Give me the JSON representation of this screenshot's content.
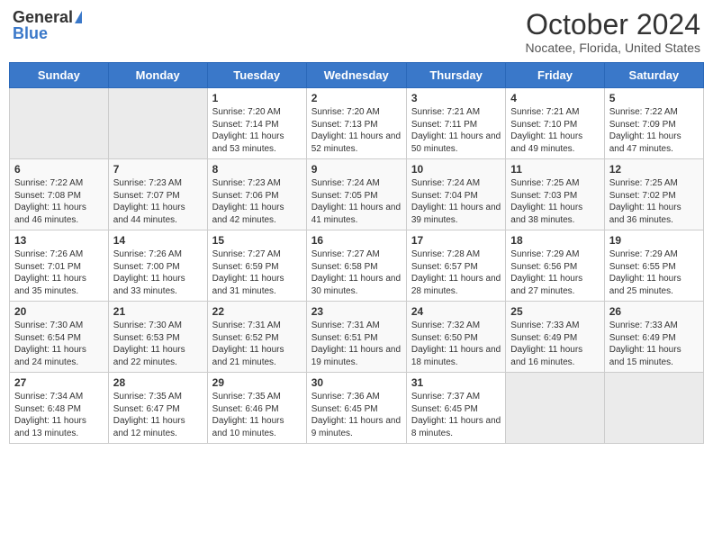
{
  "header": {
    "logo_general": "General",
    "logo_blue": "Blue",
    "month_title": "October 2024",
    "location": "Nocatee, Florida, United States"
  },
  "days_of_week": [
    "Sunday",
    "Monday",
    "Tuesday",
    "Wednesday",
    "Thursday",
    "Friday",
    "Saturday"
  ],
  "weeks": [
    [
      {
        "day": "",
        "sunrise": "",
        "sunset": "",
        "daylight": "",
        "empty": true
      },
      {
        "day": "",
        "sunrise": "",
        "sunset": "",
        "daylight": "",
        "empty": true
      },
      {
        "day": "1",
        "sunrise": "Sunrise: 7:20 AM",
        "sunset": "Sunset: 7:14 PM",
        "daylight": "Daylight: 11 hours and 53 minutes.",
        "empty": false
      },
      {
        "day": "2",
        "sunrise": "Sunrise: 7:20 AM",
        "sunset": "Sunset: 7:13 PM",
        "daylight": "Daylight: 11 hours and 52 minutes.",
        "empty": false
      },
      {
        "day": "3",
        "sunrise": "Sunrise: 7:21 AM",
        "sunset": "Sunset: 7:11 PM",
        "daylight": "Daylight: 11 hours and 50 minutes.",
        "empty": false
      },
      {
        "day": "4",
        "sunrise": "Sunrise: 7:21 AM",
        "sunset": "Sunset: 7:10 PM",
        "daylight": "Daylight: 11 hours and 49 minutes.",
        "empty": false
      },
      {
        "day": "5",
        "sunrise": "Sunrise: 7:22 AM",
        "sunset": "Sunset: 7:09 PM",
        "daylight": "Daylight: 11 hours and 47 minutes.",
        "empty": false
      }
    ],
    [
      {
        "day": "6",
        "sunrise": "Sunrise: 7:22 AM",
        "sunset": "Sunset: 7:08 PM",
        "daylight": "Daylight: 11 hours and 46 minutes.",
        "empty": false
      },
      {
        "day": "7",
        "sunrise": "Sunrise: 7:23 AM",
        "sunset": "Sunset: 7:07 PM",
        "daylight": "Daylight: 11 hours and 44 minutes.",
        "empty": false
      },
      {
        "day": "8",
        "sunrise": "Sunrise: 7:23 AM",
        "sunset": "Sunset: 7:06 PM",
        "daylight": "Daylight: 11 hours and 42 minutes.",
        "empty": false
      },
      {
        "day": "9",
        "sunrise": "Sunrise: 7:24 AM",
        "sunset": "Sunset: 7:05 PM",
        "daylight": "Daylight: 11 hours and 41 minutes.",
        "empty": false
      },
      {
        "day": "10",
        "sunrise": "Sunrise: 7:24 AM",
        "sunset": "Sunset: 7:04 PM",
        "daylight": "Daylight: 11 hours and 39 minutes.",
        "empty": false
      },
      {
        "day": "11",
        "sunrise": "Sunrise: 7:25 AM",
        "sunset": "Sunset: 7:03 PM",
        "daylight": "Daylight: 11 hours and 38 minutes.",
        "empty": false
      },
      {
        "day": "12",
        "sunrise": "Sunrise: 7:25 AM",
        "sunset": "Sunset: 7:02 PM",
        "daylight": "Daylight: 11 hours and 36 minutes.",
        "empty": false
      }
    ],
    [
      {
        "day": "13",
        "sunrise": "Sunrise: 7:26 AM",
        "sunset": "Sunset: 7:01 PM",
        "daylight": "Daylight: 11 hours and 35 minutes.",
        "empty": false
      },
      {
        "day": "14",
        "sunrise": "Sunrise: 7:26 AM",
        "sunset": "Sunset: 7:00 PM",
        "daylight": "Daylight: 11 hours and 33 minutes.",
        "empty": false
      },
      {
        "day": "15",
        "sunrise": "Sunrise: 7:27 AM",
        "sunset": "Sunset: 6:59 PM",
        "daylight": "Daylight: 11 hours and 31 minutes.",
        "empty": false
      },
      {
        "day": "16",
        "sunrise": "Sunrise: 7:27 AM",
        "sunset": "Sunset: 6:58 PM",
        "daylight": "Daylight: 11 hours and 30 minutes.",
        "empty": false
      },
      {
        "day": "17",
        "sunrise": "Sunrise: 7:28 AM",
        "sunset": "Sunset: 6:57 PM",
        "daylight": "Daylight: 11 hours and 28 minutes.",
        "empty": false
      },
      {
        "day": "18",
        "sunrise": "Sunrise: 7:29 AM",
        "sunset": "Sunset: 6:56 PM",
        "daylight": "Daylight: 11 hours and 27 minutes.",
        "empty": false
      },
      {
        "day": "19",
        "sunrise": "Sunrise: 7:29 AM",
        "sunset": "Sunset: 6:55 PM",
        "daylight": "Daylight: 11 hours and 25 minutes.",
        "empty": false
      }
    ],
    [
      {
        "day": "20",
        "sunrise": "Sunrise: 7:30 AM",
        "sunset": "Sunset: 6:54 PM",
        "daylight": "Daylight: 11 hours and 24 minutes.",
        "empty": false
      },
      {
        "day": "21",
        "sunrise": "Sunrise: 7:30 AM",
        "sunset": "Sunset: 6:53 PM",
        "daylight": "Daylight: 11 hours and 22 minutes.",
        "empty": false
      },
      {
        "day": "22",
        "sunrise": "Sunrise: 7:31 AM",
        "sunset": "Sunset: 6:52 PM",
        "daylight": "Daylight: 11 hours and 21 minutes.",
        "empty": false
      },
      {
        "day": "23",
        "sunrise": "Sunrise: 7:31 AM",
        "sunset": "Sunset: 6:51 PM",
        "daylight": "Daylight: 11 hours and 19 minutes.",
        "empty": false
      },
      {
        "day": "24",
        "sunrise": "Sunrise: 7:32 AM",
        "sunset": "Sunset: 6:50 PM",
        "daylight": "Daylight: 11 hours and 18 minutes.",
        "empty": false
      },
      {
        "day": "25",
        "sunrise": "Sunrise: 7:33 AM",
        "sunset": "Sunset: 6:49 PM",
        "daylight": "Daylight: 11 hours and 16 minutes.",
        "empty": false
      },
      {
        "day": "26",
        "sunrise": "Sunrise: 7:33 AM",
        "sunset": "Sunset: 6:49 PM",
        "daylight": "Daylight: 11 hours and 15 minutes.",
        "empty": false
      }
    ],
    [
      {
        "day": "27",
        "sunrise": "Sunrise: 7:34 AM",
        "sunset": "Sunset: 6:48 PM",
        "daylight": "Daylight: 11 hours and 13 minutes.",
        "empty": false
      },
      {
        "day": "28",
        "sunrise": "Sunrise: 7:35 AM",
        "sunset": "Sunset: 6:47 PM",
        "daylight": "Daylight: 11 hours and 12 minutes.",
        "empty": false
      },
      {
        "day": "29",
        "sunrise": "Sunrise: 7:35 AM",
        "sunset": "Sunset: 6:46 PM",
        "daylight": "Daylight: 11 hours and 10 minutes.",
        "empty": false
      },
      {
        "day": "30",
        "sunrise": "Sunrise: 7:36 AM",
        "sunset": "Sunset: 6:45 PM",
        "daylight": "Daylight: 11 hours and 9 minutes.",
        "empty": false
      },
      {
        "day": "31",
        "sunrise": "Sunrise: 7:37 AM",
        "sunset": "Sunset: 6:45 PM",
        "daylight": "Daylight: 11 hours and 8 minutes.",
        "empty": false
      },
      {
        "day": "",
        "sunrise": "",
        "sunset": "",
        "daylight": "",
        "empty": true
      },
      {
        "day": "",
        "sunrise": "",
        "sunset": "",
        "daylight": "",
        "empty": true
      }
    ]
  ]
}
